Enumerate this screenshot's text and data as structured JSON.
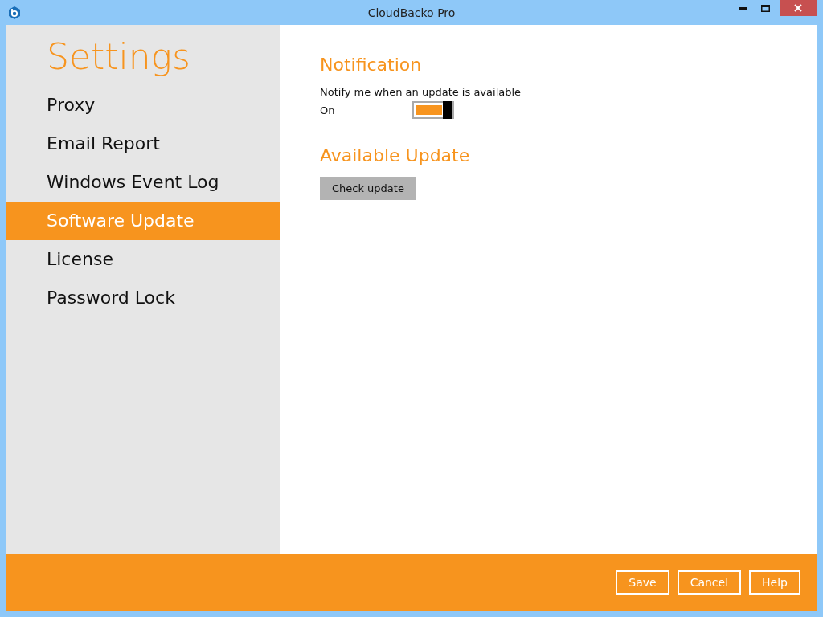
{
  "window": {
    "title": "CloudBacko Pro"
  },
  "sidebar": {
    "title": "Settings",
    "items": [
      {
        "label": "Proxy",
        "selected": false
      },
      {
        "label": "Email Report",
        "selected": false
      },
      {
        "label": "Windows Event Log",
        "selected": false
      },
      {
        "label": "Software Update",
        "selected": true
      },
      {
        "label": "License",
        "selected": false
      },
      {
        "label": "Password Lock",
        "selected": false
      }
    ]
  },
  "notification": {
    "heading": "Notification",
    "label": "Notify me when an update is available",
    "state_text": "On",
    "on": true
  },
  "available_update": {
    "heading": "Available Update",
    "button": "Check update"
  },
  "buttons": [
    "Save",
    "Cancel",
    "Help"
  ]
}
